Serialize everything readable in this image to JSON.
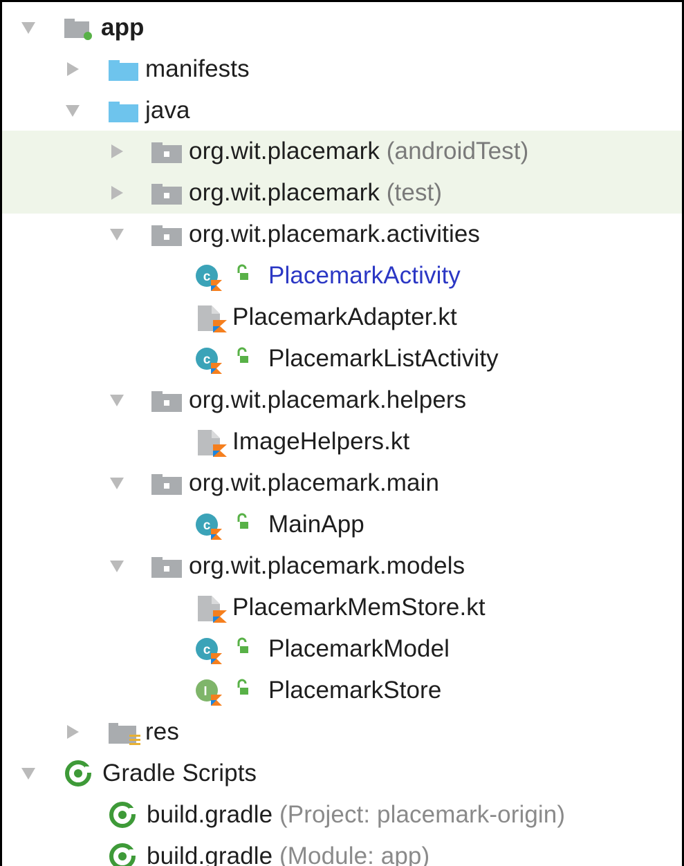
{
  "colors": {
    "highlight": "#eff5e9",
    "folder_blue": "#6ec4ed",
    "package_gray": "#a9acaf",
    "kotlin_orange": "#f57f1e",
    "kotlin_blue": "#1b86e0",
    "class_teal": "#3ba3b8",
    "interface_green": "#7fb56a",
    "access_green": "#58b147",
    "gradle_green": "#3e9a38",
    "secondary_text": "#8a8a8a",
    "link_blue": "#2b37c4"
  },
  "tree": {
    "nodes": [
      {
        "label": "app",
        "suffix": "",
        "icon": "app-module-icon",
        "expanded": "expanded"
      },
      {
        "label": "manifests",
        "suffix": "",
        "icon": "folder-icon",
        "expanded": "collapsed"
      },
      {
        "label": "java",
        "suffix": "",
        "icon": "folder-icon",
        "expanded": "expanded"
      },
      {
        "label": "org.wit.placemark",
        "suffix": "(androidTest)",
        "icon": "package-icon",
        "expanded": "collapsed"
      },
      {
        "label": "org.wit.placemark",
        "suffix": "(test)",
        "icon": "package-icon",
        "expanded": "collapsed"
      },
      {
        "label": "org.wit.placemark.activities",
        "suffix": "",
        "icon": "package-icon",
        "expanded": "expanded"
      },
      {
        "label": "PlacemarkActivity",
        "suffix": "",
        "icon": "kotlin-class-icon",
        "expanded": ""
      },
      {
        "label": "PlacemarkAdapter.kt",
        "suffix": "",
        "icon": "kotlin-file-icon",
        "expanded": ""
      },
      {
        "label": "PlacemarkListActivity",
        "suffix": "",
        "icon": "kotlin-class-icon",
        "expanded": ""
      },
      {
        "label": "org.wit.placemark.helpers",
        "suffix": "",
        "icon": "package-icon",
        "expanded": "expanded"
      },
      {
        "label": "ImageHelpers.kt",
        "suffix": "",
        "icon": "kotlin-file-icon",
        "expanded": ""
      },
      {
        "label": "org.wit.placemark.main",
        "suffix": "",
        "icon": "package-icon",
        "expanded": "expanded"
      },
      {
        "label": "MainApp",
        "suffix": "",
        "icon": "kotlin-class-icon",
        "expanded": ""
      },
      {
        "label": "org.wit.placemark.models",
        "suffix": "",
        "icon": "package-icon",
        "expanded": "expanded"
      },
      {
        "label": "PlacemarkMemStore.kt",
        "suffix": "",
        "icon": "kotlin-file-icon",
        "expanded": ""
      },
      {
        "label": "PlacemarkModel",
        "suffix": "",
        "icon": "kotlin-class-icon",
        "expanded": ""
      },
      {
        "label": "PlacemarkStore",
        "suffix": "",
        "icon": "kotlin-interface-icon",
        "expanded": ""
      },
      {
        "label": "res",
        "suffix": "",
        "icon": "resource-folder-icon",
        "expanded": "collapsed"
      },
      {
        "label": "Gradle Scripts",
        "suffix": "",
        "icon": "gradle-icon",
        "expanded": "expanded"
      },
      {
        "label": "build.gradle",
        "suffix": "(Project: placemark-origin)",
        "icon": "gradle-icon",
        "expanded": ""
      },
      {
        "label": "build.gradle",
        "suffix": "(Module: app)",
        "icon": "gradle-icon",
        "expanded": ""
      }
    ]
  }
}
